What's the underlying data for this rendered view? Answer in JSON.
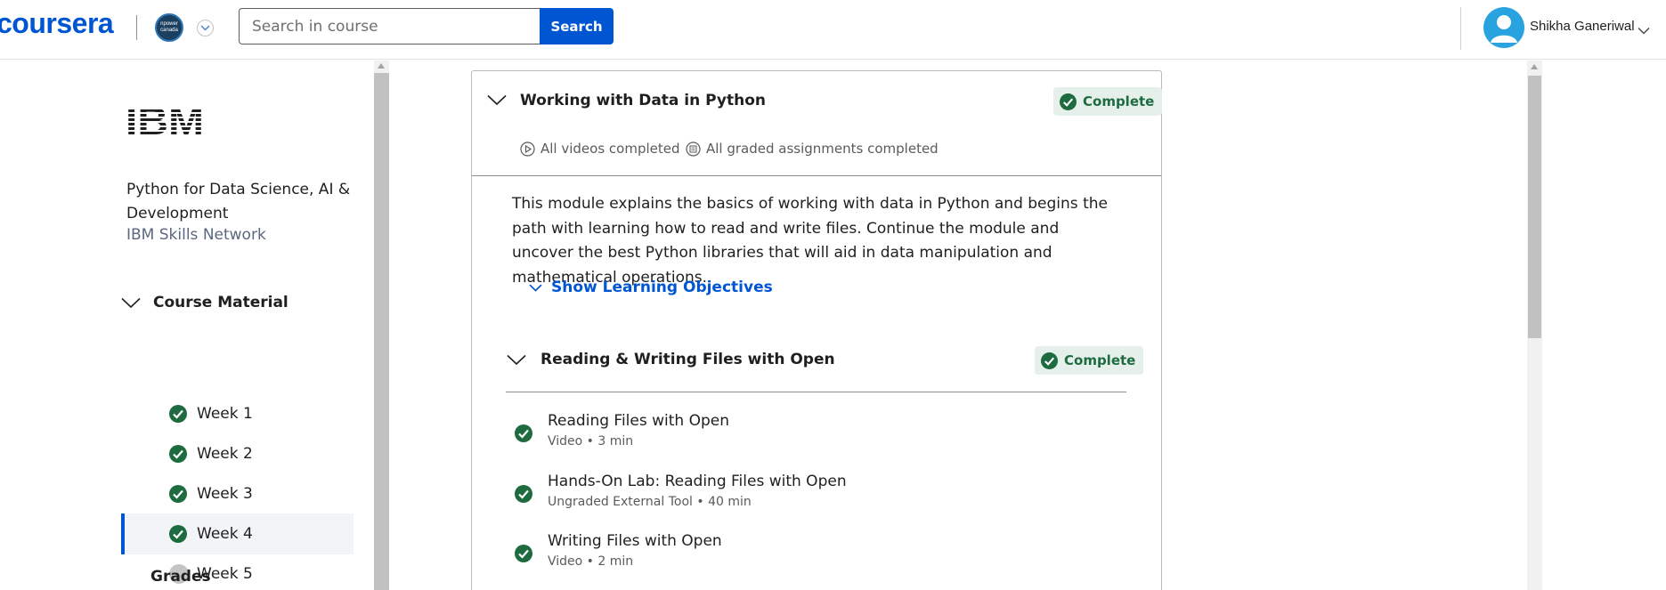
{
  "header": {
    "logo_text": "coursera",
    "org_logo_text": "npower canada",
    "search": {
      "placeholder": "Search in course",
      "button_label": "Search"
    },
    "user": {
      "name": "Shikha Ganeriwal"
    }
  },
  "sidebar": {
    "partner_logo_text": "IBM",
    "course_title": "Python for Data Science, AI & Development",
    "course_partner": "IBM Skills Network",
    "course_material_label": "Course Material",
    "weeks": [
      {
        "label": "Week 1",
        "status": "complete"
      },
      {
        "label": "Week 2",
        "status": "complete"
      },
      {
        "label": "Week 3",
        "status": "complete"
      },
      {
        "label": "Week 4",
        "status": "complete",
        "selected": true
      },
      {
        "label": "Week 5",
        "status": "not-started"
      }
    ],
    "grades_label": "Grades"
  },
  "module": {
    "title": "Working with Data in Python",
    "status_label": "Complete",
    "videos_status": "All videos completed",
    "assignments_status": "All graded assignments completed",
    "description": "This module explains the basics of working with data in Python and begins the path with learning how to read and write files. Continue the module and uncover the best Python libraries that will aid in data manipulation and mathematical operations.",
    "show_objectives_label": "Show Learning Objectives",
    "lesson": {
      "title": "Reading & Writing Files with Open",
      "status_label": "Complete",
      "items": [
        {
          "title": "Reading Files with Open",
          "type": "Video",
          "duration": "3 min",
          "meta": "Video • 3 min"
        },
        {
          "title": "Hands-On Lab: Reading Files with Open",
          "type": "Ungraded External Tool",
          "duration": "40 min",
          "meta": "Ungraded External Tool • 40 min"
        },
        {
          "title": "Writing Files with Open",
          "type": "Video",
          "duration": "2 min",
          "meta": "Video • 2 min"
        }
      ]
    }
  },
  "colors": {
    "brand_blue": "#0056d2",
    "complete_green": "#1e6b40",
    "complete_badge_bg": "#e6f0eb",
    "not_started_gray": "#c4c4c4"
  }
}
